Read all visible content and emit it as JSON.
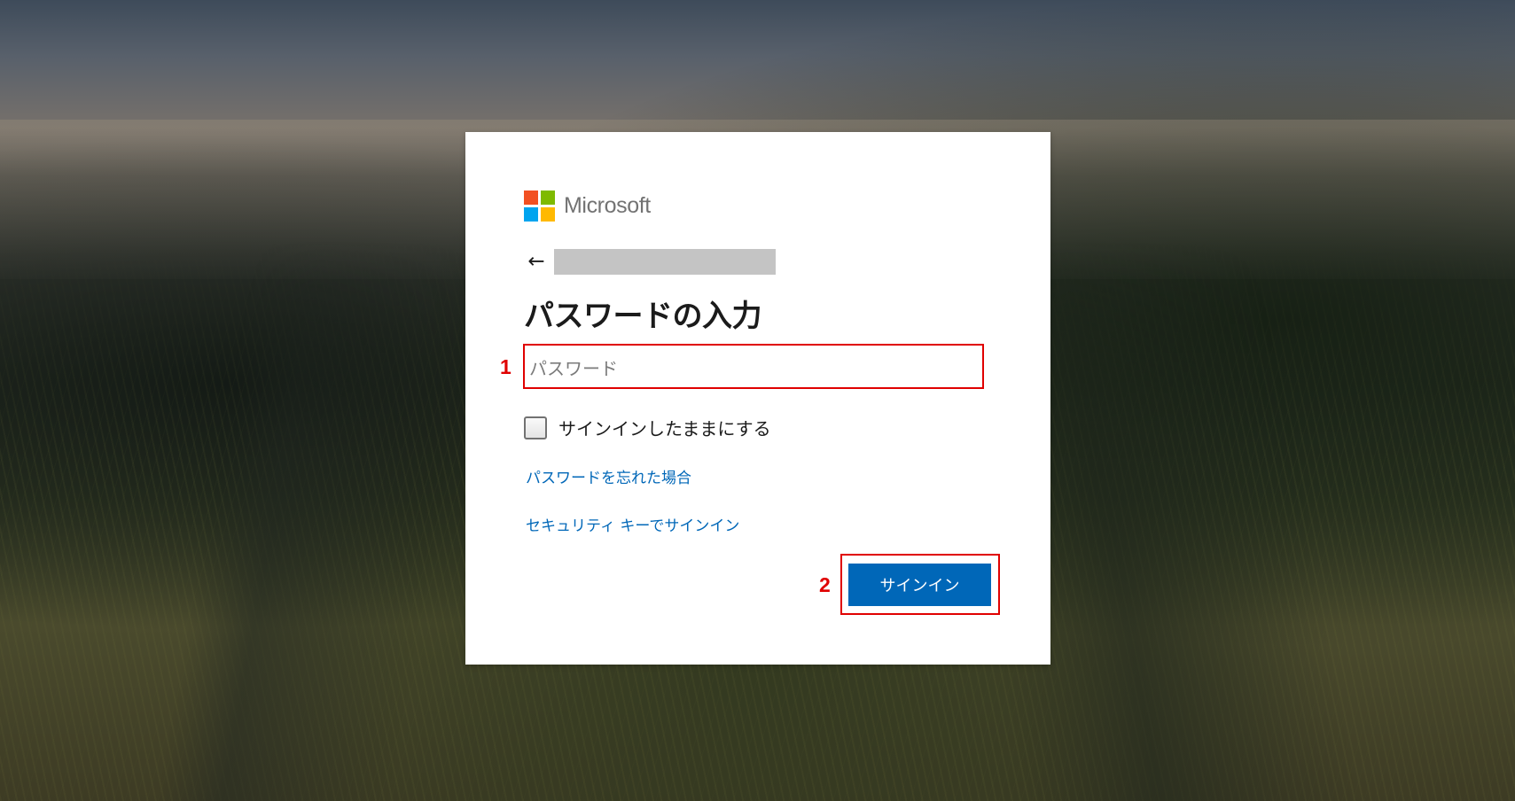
{
  "card": {
    "brand": {
      "name": "Microsoft",
      "logo_colors": [
        "#f25022",
        "#7fba00",
        "#00a4ef",
        "#ffb900"
      ]
    },
    "back_icon": "←",
    "title": "パスワードの入力",
    "password": {
      "value": "",
      "placeholder": "パスワード"
    },
    "remember": {
      "label": "サインインしたままにする",
      "checked": false
    },
    "links": {
      "forgot_password": "パスワードを忘れた場合",
      "security_key": "セキュリティ キーでサインイン"
    },
    "signin_label": "サインイン"
  },
  "annotations": {
    "password_marker": "1",
    "signin_marker": "2",
    "highlight_color": "#e00000"
  },
  "colors": {
    "accent": "#0067b8",
    "title_text": "#1b1b1b",
    "redaction": "#c4c4c4"
  }
}
